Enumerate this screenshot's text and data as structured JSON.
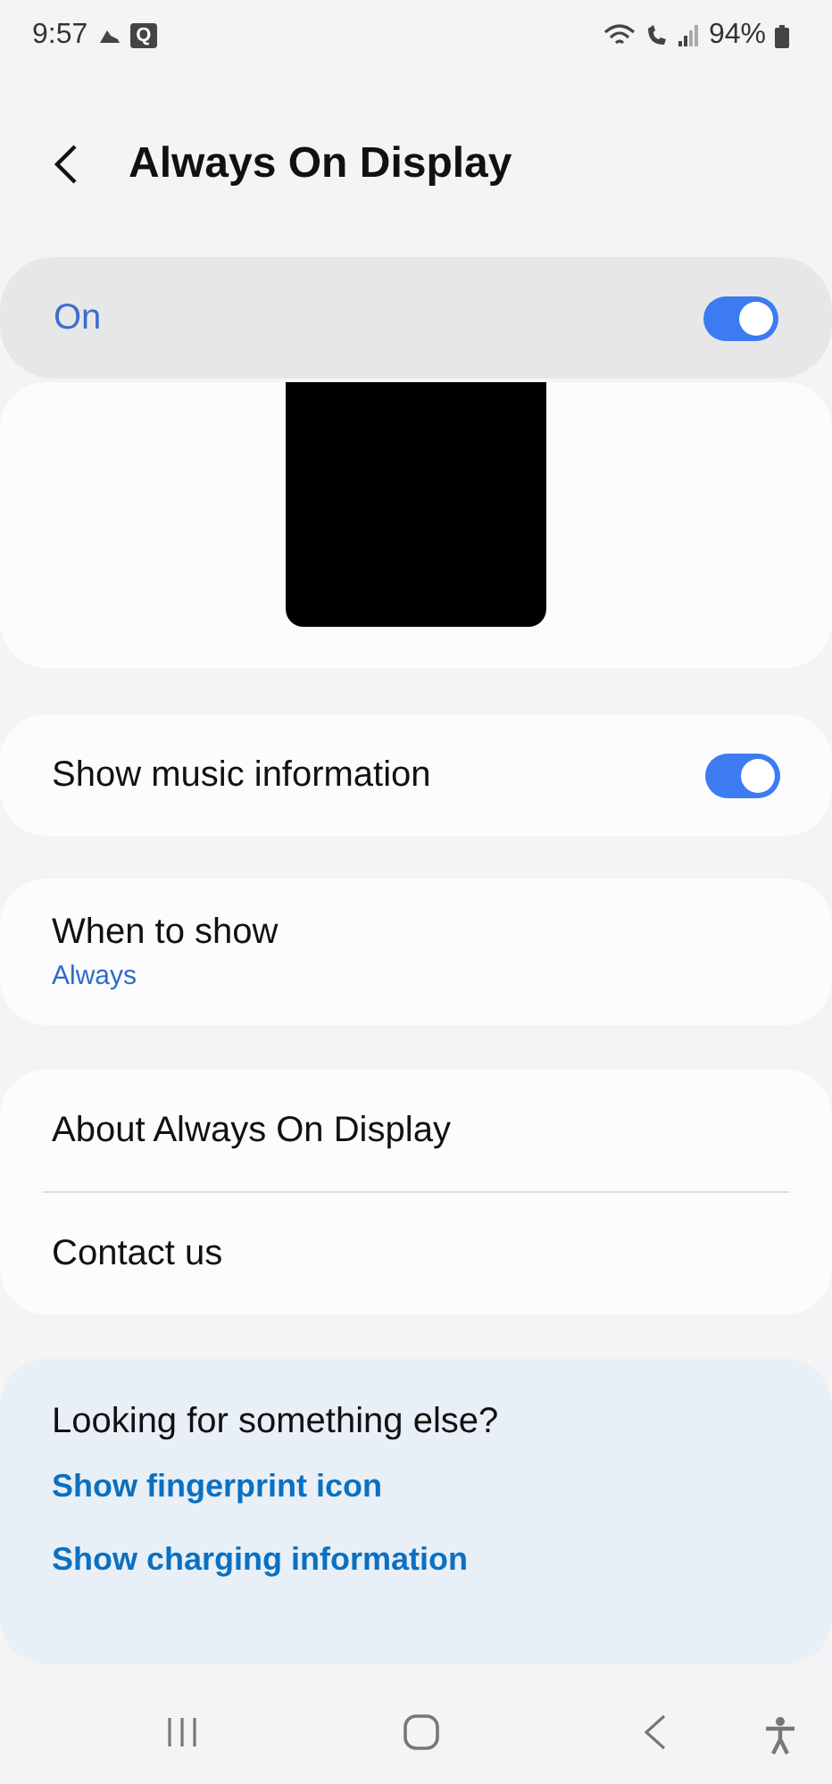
{
  "status_bar": {
    "time": "9:57",
    "badge": "Q",
    "battery": "94%"
  },
  "header": {
    "title": "Always On Display"
  },
  "master": {
    "label": "On",
    "on": true
  },
  "items": [
    {
      "kind": "toggle",
      "label": "Show music information",
      "on": true
    },
    {
      "kind": "value",
      "label": "When to show",
      "value": "Always"
    }
  ],
  "links": [
    "About Always On Display",
    "Contact us"
  ],
  "suggestions": {
    "title": "Looking for something else?",
    "links": [
      "Show fingerprint icon",
      "Show charging information"
    ]
  }
}
